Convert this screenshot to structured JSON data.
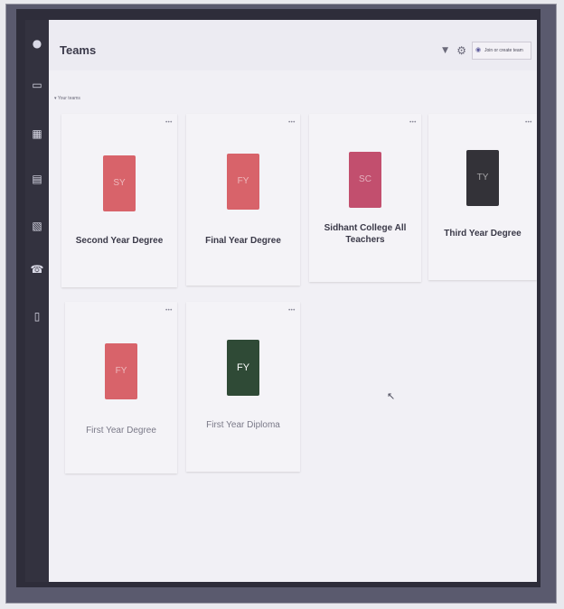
{
  "app": {
    "title": "Teams",
    "join_button_label": "Join or create team",
    "section_label": "Your teams"
  },
  "icons": {
    "rail": [
      "activity-icon",
      "chat-icon",
      "teams-icon",
      "assignments-icon",
      "calendar-icon",
      "calls-icon",
      "files-icon"
    ],
    "header": [
      "filter-icon",
      "settings-icon",
      "join-team-icon"
    ]
  },
  "teams": [
    {
      "name": "Second Year Degree",
      "tile_color": "#d8636a",
      "tile_text": "SY"
    },
    {
      "name": "Final Year Degree",
      "tile_color": "#d8636a",
      "tile_text": "FY"
    },
    {
      "name": "Sidhant College All Teachers",
      "tile_color": "#c24f6e",
      "tile_text": "SC"
    },
    {
      "name": "Third Year Degree",
      "tile_color": "#333238",
      "tile_text": "TY"
    },
    {
      "name": "First Year Degree",
      "tile_color": "#d8636a",
      "tile_text": "FY"
    },
    {
      "name": "First Year Diploma",
      "tile_color": "#2f4a36",
      "tile_text": "FY"
    }
  ],
  "colors": {
    "rail": "#33323f",
    "background": "#f1f0f5",
    "accent": "#5b5a9a"
  }
}
